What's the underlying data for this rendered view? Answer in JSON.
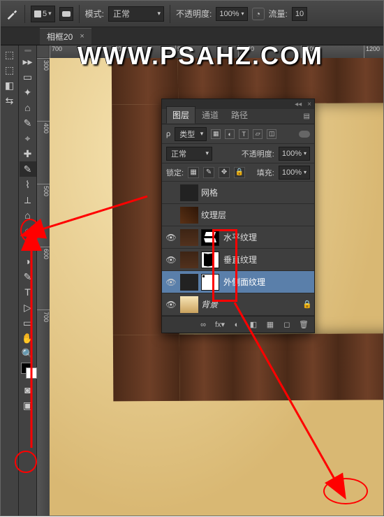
{
  "watermark": "WWW.PSAHZ.COM",
  "optionsbar": {
    "brush_size": "5",
    "mode_label": "模式:",
    "mode_value": "正常",
    "opacity_label": "不透明度:",
    "opacity_value": "100%",
    "flow_label": "流量:",
    "flow_value": "10"
  },
  "doc_tab": {
    "title": "相框20",
    "title_rest": "…",
    "close": "×"
  },
  "ruler_h": [
    "700",
    "800",
    "900",
    "1000",
    "1100",
    "1200"
  ],
  "ruler_v": [
    "300",
    "400",
    "500",
    "600",
    "700"
  ],
  "layers_panel": {
    "tabs": {
      "layers": "图层",
      "channels": "通道",
      "paths": "路径"
    },
    "filter_label": "类型",
    "blend_mode": "正常",
    "opacity_label": "不透明度:",
    "opacity_value": "100%",
    "lock_label": "锁定:",
    "fill_label": "填充:",
    "fill_value": "100%",
    "layers": [
      {
        "name": "网格",
        "visible": false,
        "mask": null,
        "thumb": "trans"
      },
      {
        "name": "纹理层",
        "visible": false,
        "mask": null,
        "thumb": "tex"
      },
      {
        "name": "水平纹理",
        "visible": true,
        "mask": "hmask",
        "thumb": "wood"
      },
      {
        "name": "垂直纹理",
        "visible": true,
        "mask": "vmask",
        "thumb": "wood"
      },
      {
        "name": "外侧面纹理",
        "visible": true,
        "mask": "omask",
        "thumb": "trans",
        "selected": true
      },
      {
        "name": "背景",
        "visible": true,
        "mask": null,
        "thumb": "grad",
        "locked": true,
        "italic": true
      }
    ],
    "foot": [
      "∞",
      "fx▾",
      "◐",
      "◧",
      "▦",
      "◻",
      "🗑"
    ]
  },
  "tools_left": [
    "▸▸",
    "▭",
    "✦",
    "⌂",
    "✎",
    "⌖",
    "✚",
    "✎",
    "⌇",
    "⟂",
    "⌂",
    "◌",
    "△",
    "◑",
    "✎",
    "T",
    "▷",
    "▭",
    "✋",
    "🔍"
  ],
  "tools_farleft": [
    "⬚",
    "⬚",
    "◧",
    "⇆"
  ]
}
